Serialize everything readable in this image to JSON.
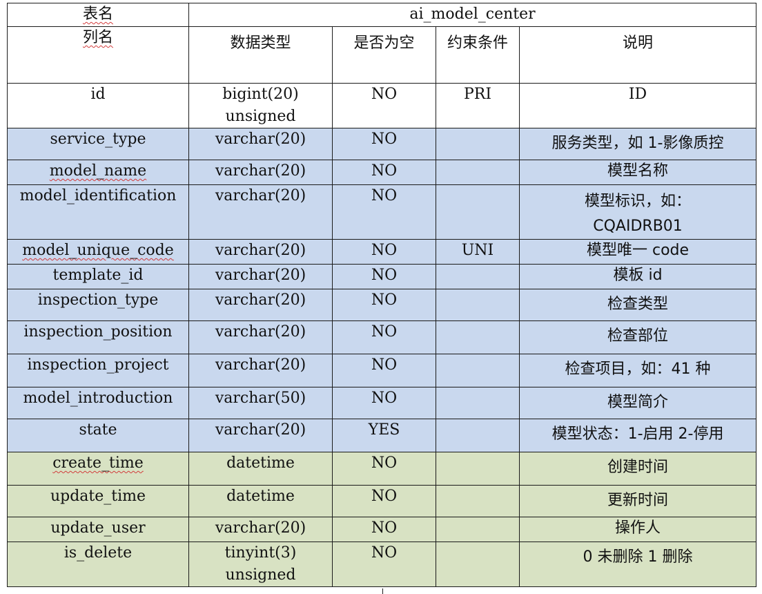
{
  "table": {
    "table_name_label": "表名",
    "table_name": "ai_model_center",
    "headers": {
      "column_name": "列名",
      "data_type": "数据类型",
      "nullable": "是否为空",
      "constraint": "约束条件",
      "description": "说明"
    },
    "rows": [
      {
        "name": "id",
        "type": "bigint(20) unsigned",
        "nullable": "NO",
        "constraint": "PRI",
        "desc": "ID"
      },
      {
        "name": "service_type",
        "type": "varchar(20)",
        "nullable": "NO",
        "constraint": "",
        "desc": "服务类型，如 1-影像质控"
      },
      {
        "name": "model_name",
        "type": "varchar(20)",
        "nullable": "NO",
        "constraint": "",
        "desc": "模型名称"
      },
      {
        "name": "model_identification",
        "type": "varchar(20)",
        "nullable": "NO",
        "constraint": "",
        "desc": "模型标识，如：CQAIDRB01"
      },
      {
        "name": "model_unique_code",
        "type": "varchar(20)",
        "nullable": "NO",
        "constraint": "UNI",
        "desc": "模型唯一 code"
      },
      {
        "name": "template_id",
        "type": "varchar(20)",
        "nullable": "NO",
        "constraint": "",
        "desc": "模板 id"
      },
      {
        "name": "inspection_type",
        "type": "varchar(20)",
        "nullable": "NO",
        "constraint": "",
        "desc": "检查类型"
      },
      {
        "name": "inspection_position",
        "type": "varchar(20)",
        "nullable": "NO",
        "constraint": "",
        "desc": "检查部位"
      },
      {
        "name": "inspection_project",
        "type": "varchar(20)",
        "nullable": "NO",
        "constraint": "",
        "desc": "检查项目，如：41 种"
      },
      {
        "name": "model_introduction",
        "type": "varchar(50)",
        "nullable": "NO",
        "constraint": "",
        "desc": "模型简介"
      },
      {
        "name": "state",
        "type": "varchar(20)",
        "nullable": "YES",
        "constraint": "",
        "desc": "模型状态：1-启用 2-停用"
      },
      {
        "name": "create_time",
        "type": "datetime",
        "nullable": "NO",
        "constraint": "",
        "desc": "创建时间"
      },
      {
        "name": "update_time",
        "type": "datetime",
        "nullable": "NO",
        "constraint": "",
        "desc": "更新时间"
      },
      {
        "name": "update_user",
        "type": "varchar(20)",
        "nullable": "NO",
        "constraint": "",
        "desc": "操作人"
      },
      {
        "name": "is_delete",
        "type": "tinyint(3) unsigned",
        "nullable": "NO",
        "constraint": "",
        "desc": "0 未删除 1 删除"
      }
    ]
  },
  "colors": {
    "row_blue": "#c9d8ee",
    "row_green": "#d8e2c3",
    "spellcheck_underline": "#d23b3b"
  }
}
